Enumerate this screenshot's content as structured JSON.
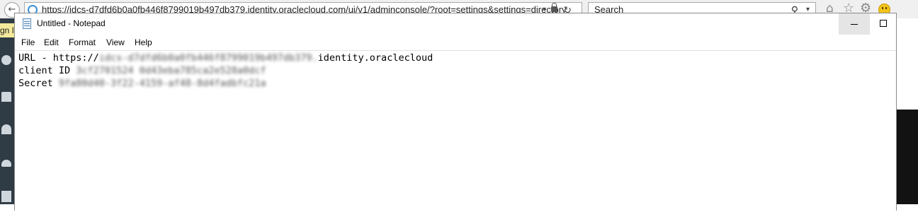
{
  "browser": {
    "url": "https://idcs-d7dfd6b0a0fb446f8799019b497db379.identity.oraclecloud.com/ui/v1/adminconsole/?root=settings&settings=directory",
    "search_placeholder": "Search",
    "address_dropdown": "▾",
    "refresh_glyph": "↻",
    "search_glyph": "⚲",
    "search_dropdown": "▾",
    "home_glyph": "⌂",
    "favorites_glyph": "☆",
    "tools_glyph": "⚙",
    "back_glyph": "←"
  },
  "page_behind": {
    "sign_in_label": "gn In"
  },
  "notepad": {
    "title": "Untitled - Notepad",
    "menu": [
      "File",
      "Edit",
      "Format",
      "View",
      "Help"
    ],
    "lines": {
      "url_label": "URL - https://",
      "url_blurred": "idcs-d7dfd6b0a0fb446f8799019b497db379.",
      "url_suffix": "identity.oraclecloud",
      "client_label": "client ID ",
      "client_blurred": "3cf2701524 0d43eba785ca2e528a0dcf",
      "secret_label": "Secret ",
      "secret_blurred": "9fa80d40-3f22-4159-af48-8d4fadbfc21a"
    }
  },
  "colors": {
    "page_strip": "#2f3b45",
    "sign_in_bg": "#f3ea9c",
    "minimize_hover": "#e5e5e5"
  }
}
